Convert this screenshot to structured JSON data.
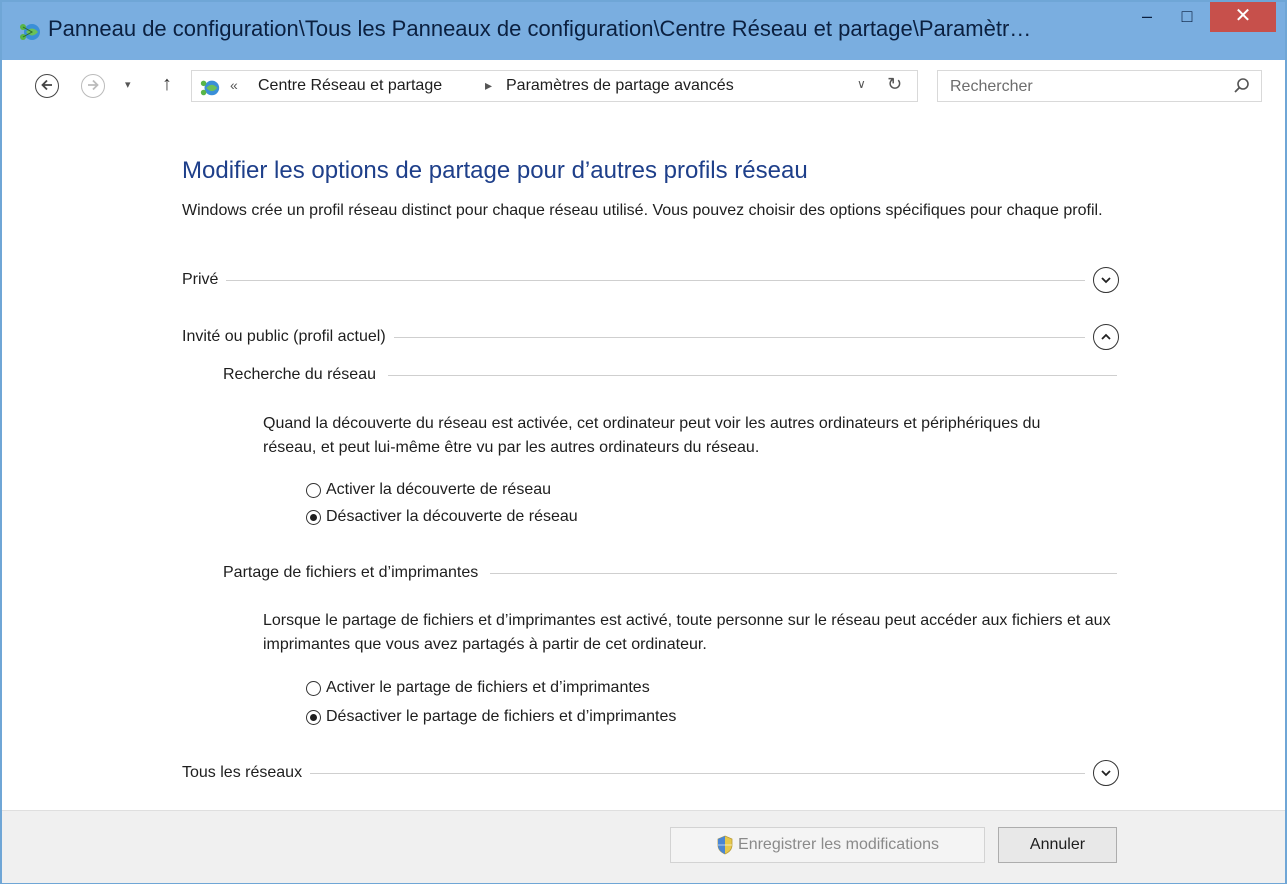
{
  "window": {
    "title": "Panneau de configuration\\Tous les Panneaux de configuration\\Centre Réseau et partage\\Paramètr…",
    "minimize": "–",
    "maximize": "□",
    "close": "✕"
  },
  "address_bar": {
    "history_dropdown": "▾",
    "up_arrow": "↑",
    "overflow_chevrons": "«",
    "separator": "▸",
    "breadcrumbs": [
      "Centre Réseau et partage",
      "Paramètres de partage avancés"
    ],
    "dropdown": "∨",
    "refresh": "↻"
  },
  "search": {
    "placeholder": "Rechercher"
  },
  "page": {
    "heading": "Modifier les options de partage pour d’autres profils réseau",
    "description": "Windows crée un profil réseau distinct pour chaque réseau utilisé. Vous pouvez choisir des options spécifiques pour chaque profil."
  },
  "profiles": {
    "private": {
      "label": "Privé",
      "expanded": false
    },
    "guest_public": {
      "label": "Invité ou public (profil actuel)",
      "expanded": true
    },
    "all_networks": {
      "label": "Tous les réseaux",
      "expanded": false
    }
  },
  "network_discovery": {
    "title": "Recherche du réseau",
    "description": "Quand la découverte du réseau est activée, cet ordinateur peut voir les autres ordinateurs et périphériques du réseau, et peut lui-même être vu par les autres ordinateurs du réseau.",
    "options": [
      "Activer la découverte de réseau",
      "Désactiver la découverte de réseau"
    ],
    "selected": 1
  },
  "file_printer_sharing": {
    "title": "Partage de fichiers et d’imprimantes",
    "description": "Lorsque le partage de fichiers et d’imprimantes est activé, toute personne sur le réseau peut accéder aux fichiers et aux imprimantes que vous avez partagés à partir de cet ordinateur.",
    "options": [
      "Activer le partage de fichiers et d’imprimantes",
      "Désactiver le partage de fichiers et d’imprimantes"
    ],
    "selected": 1
  },
  "footer": {
    "save_label": "Enregistrer les modifications",
    "save_enabled": false,
    "cancel_label": "Annuler"
  },
  "colors": {
    "titlebar": "#7aaee0",
    "close_button": "#c7504b",
    "heading": "#1e3f8a",
    "footer": "#f0f0f0"
  },
  "icons": {
    "title": "network-sharing-icon",
    "back": "back-arrow-icon",
    "forward": "forward-arrow-icon",
    "search": "search-icon",
    "shield": "uac-shield-icon",
    "expand": "chevron-down-icon",
    "collapse": "chevron-up-icon"
  }
}
